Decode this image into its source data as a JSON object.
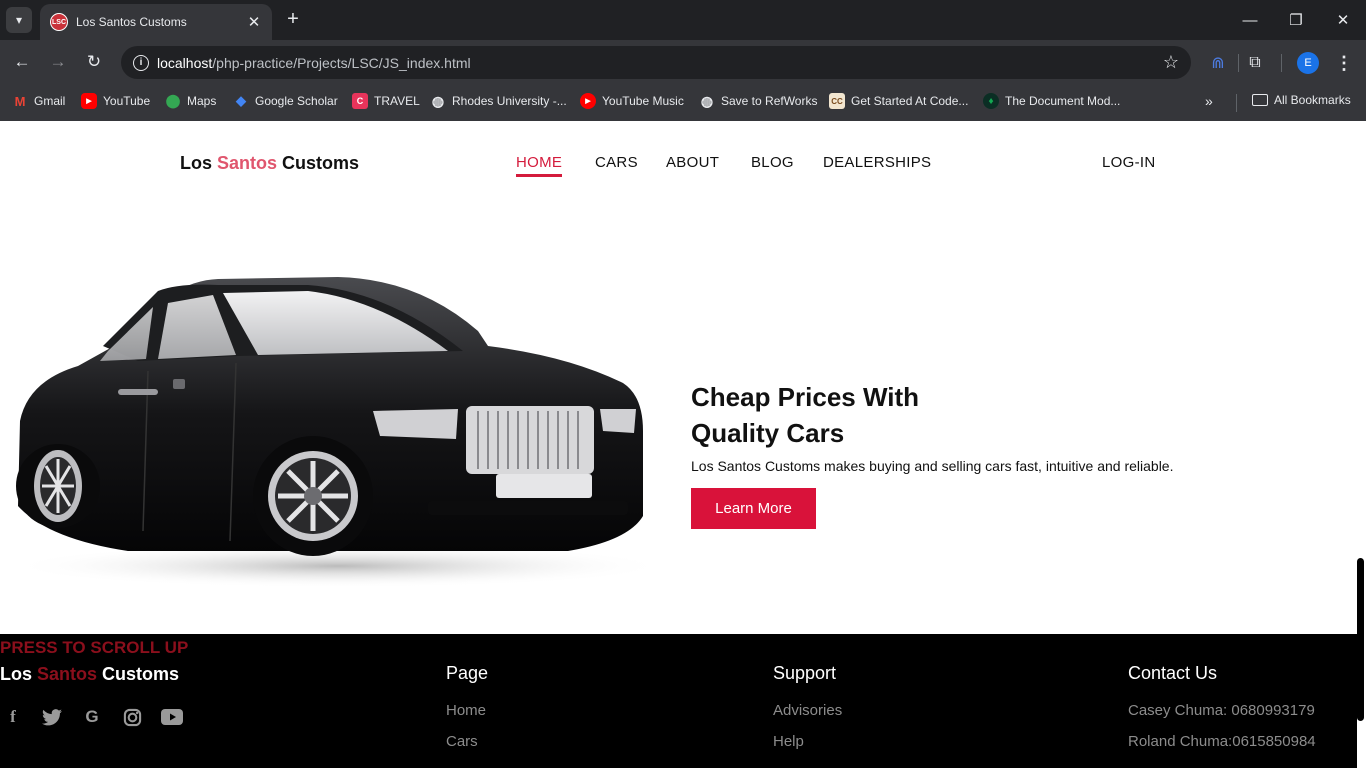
{
  "browser": {
    "tab_title": "Los Santos Customs",
    "favicon_text": "LSC",
    "url_host": "localhost",
    "url_path": "/php-practice/Projects/LSC/JS_index.html",
    "profile_initial": "E",
    "bookmarks": [
      {
        "label": "Gmail",
        "icon": "gmail-icon",
        "color": "#ea4335"
      },
      {
        "label": "YouTube",
        "icon": "youtube-icon",
        "color": "#ff0000"
      },
      {
        "label": "Maps",
        "icon": "maps-icon",
        "color": "#34a853"
      },
      {
        "label": "Google Scholar",
        "icon": "scholar-icon",
        "color": "#4285f4"
      },
      {
        "label": "TRAVEL",
        "icon": "travel-icon",
        "color": "#e8345b"
      },
      {
        "label": "Rhodes University -...",
        "icon": "globe-icon",
        "color": "#e8eaed"
      },
      {
        "label": "YouTube Music",
        "icon": "youtube-music-icon",
        "color": "#ff0000"
      },
      {
        "label": "Save to RefWorks",
        "icon": "globe-icon",
        "color": "#e8eaed"
      },
      {
        "label": "Get Started At Code...",
        "icon": "codecademy-icon",
        "color": "#f2e6d0"
      },
      {
        "label": "The Document Mod...",
        "icon": "mongodb-icon",
        "color": "#13aa52"
      }
    ],
    "all_bookmarks": "All Bookmarks"
  },
  "site": {
    "logo": {
      "part1": "Los ",
      "accent": "Santos",
      "part2": " Customs"
    },
    "nav": {
      "home": "HOME",
      "cars": "CARS",
      "about": "ABOUT",
      "blog": "BLOG",
      "dealerships": "DEALERSHIPS",
      "login": "LOG-IN"
    },
    "hero": {
      "title": "Cheap Prices With Quality Cars",
      "text": "Los Santos Customs makes buying and selling cars fast, intuitive and reliable.",
      "button": "Learn More"
    },
    "footer": {
      "scroll_up": "PRESS TO SCROLL UP",
      "page_heading": "Page",
      "page_links": [
        "Home",
        "Cars"
      ],
      "support_heading": "Support",
      "support_links": [
        "Advisories",
        "Help"
      ],
      "contact_heading": "Contact Us",
      "contacts": [
        "Casey Chuma: 0680993179",
        "Roland Chuma:0615850984"
      ]
    },
    "colors": {
      "accent": "#d9123a",
      "logo_accent": "#e0566e",
      "footer_accent": "#8b0f1c"
    }
  }
}
